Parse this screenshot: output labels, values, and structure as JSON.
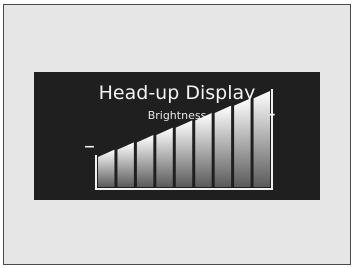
{
  "display": {
    "title": "Head-up Display",
    "subtitle": "Brightness",
    "decrease_symbol": "–",
    "increase_symbol": "+"
  },
  "brightness": {
    "level": 9,
    "max_level": 9
  },
  "colors": {
    "screen_background": "#1f1f1f",
    "text": "#f2f2f2",
    "frame_background": "#e6e6e6",
    "frame_border": "#4a4a4a",
    "bar_gradient_top": "#ffffff",
    "bar_gradient_bottom": "#5a5a5a"
  }
}
